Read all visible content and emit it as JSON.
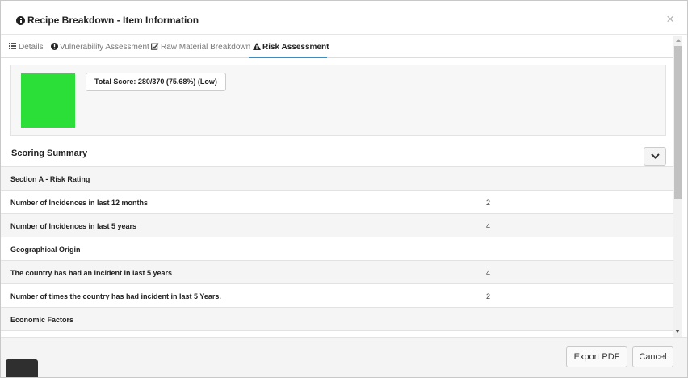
{
  "modal": {
    "title": "Recipe Breakdown - Item Information",
    "close_label": "×"
  },
  "tabs": [
    {
      "label": "Details",
      "icon": "list-icon",
      "active": false
    },
    {
      "label": "Vulnerability Assessment",
      "icon": "exclamation-circle-icon",
      "active": false
    },
    {
      "label": "Raw Material Breakdown",
      "icon": "check-square-icon",
      "active": false
    },
    {
      "label": "Risk Assessment",
      "icon": "warning-triangle-icon",
      "active": true
    }
  ],
  "score": {
    "text": "Total Score: 280/370 (75.68%) (Low)",
    "color": "#2bde38"
  },
  "summary": {
    "title": "Scoring Summary",
    "rows": [
      {
        "name": "Section A - Risk Rating",
        "value": ""
      },
      {
        "name": "Number of Incidences in last 12 months",
        "value": "2"
      },
      {
        "name": "Number of Incidences in last 5 years",
        "value": "4"
      },
      {
        "name": "Geographical Origin",
        "value": ""
      },
      {
        "name": "The country has had an incident in last 5 years",
        "value": "4"
      },
      {
        "name": "Number of times the country has had incident in last 5 Years.",
        "value": "2"
      },
      {
        "name": "Economic Factors",
        "value": ""
      }
    ]
  },
  "footer": {
    "export_label": "Export PDF",
    "cancel_label": "Cancel"
  },
  "colors": {
    "accent": "#3c8dbc",
    "score_low": "#2bde38"
  }
}
